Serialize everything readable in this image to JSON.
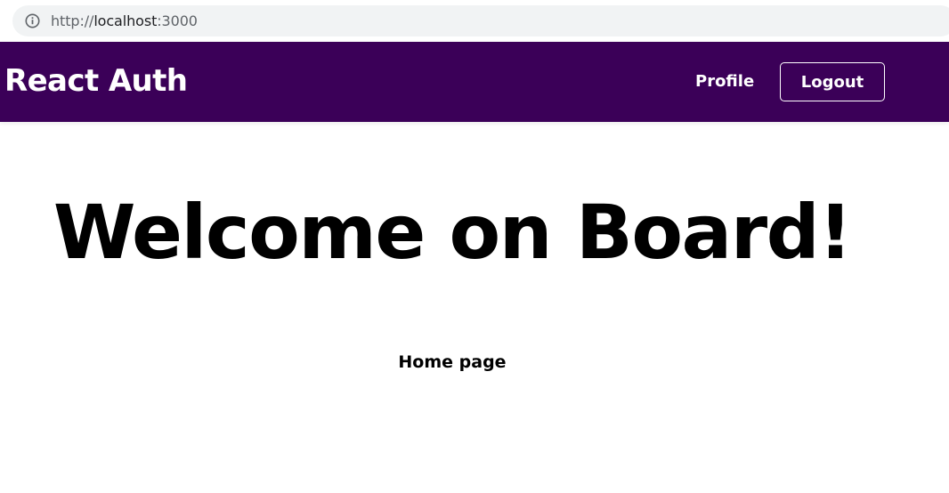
{
  "browser": {
    "url_scheme": "http://",
    "url_host": "localhost",
    "url_port": ":3000",
    "info_icon": "info-icon"
  },
  "navbar": {
    "brand": "React Auth",
    "profile_link": "Profile",
    "logout_button": "Logout",
    "background_color": "#3b0058"
  },
  "main": {
    "title": "Welcome on Board!",
    "subtitle": "Home page"
  }
}
